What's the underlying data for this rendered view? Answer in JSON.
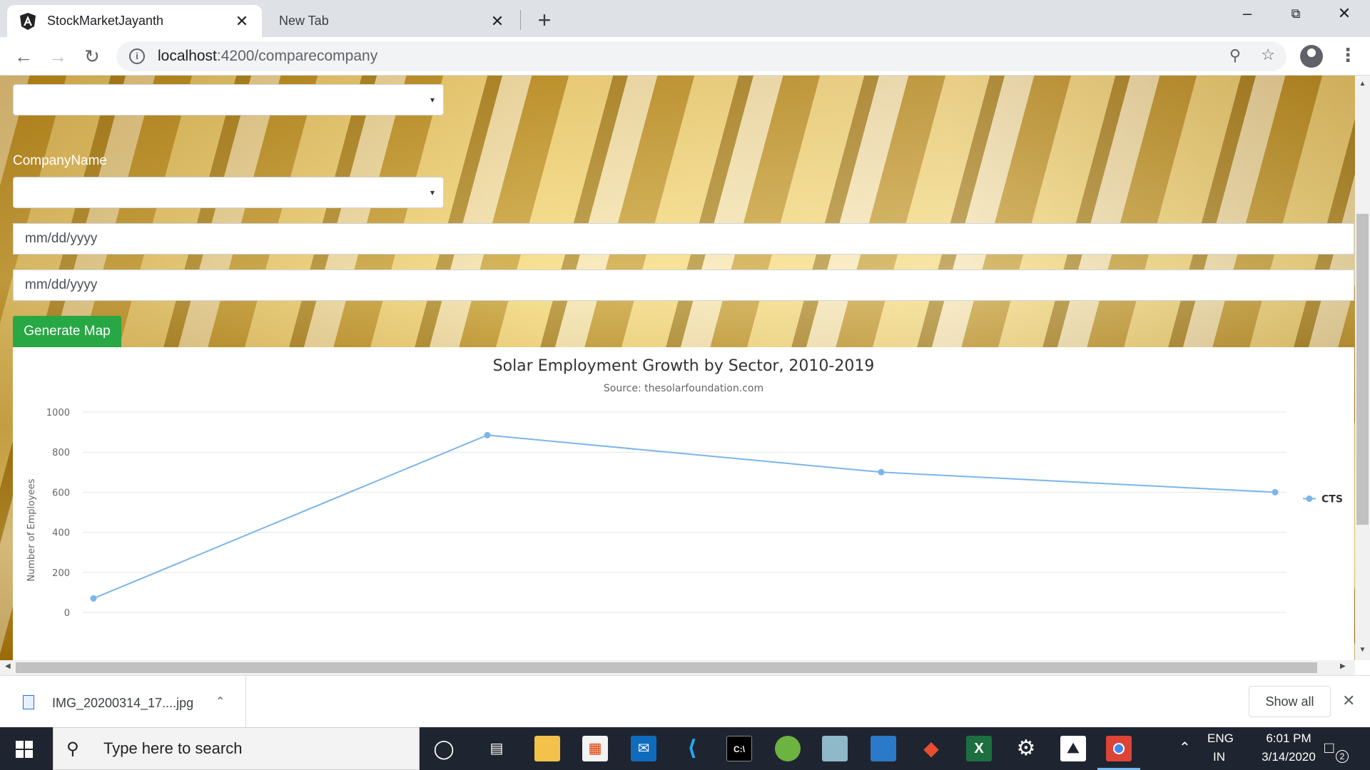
{
  "browser": {
    "tabs": [
      {
        "title": "StockMarketJayanth",
        "active": true
      },
      {
        "title": "New Tab",
        "active": false
      }
    ],
    "url_host": "localhost",
    "url_path": ":4200/comparecompany",
    "new_tab_symbol": "+",
    "close_symbol": "✕"
  },
  "form": {
    "company_label": "CompanyName",
    "caret": "▾",
    "from_date_placeholder": "mm/dd/yyyy",
    "to_date_placeholder": "mm/dd/yyyy",
    "generate_label": "Generate Map"
  },
  "chart_data": {
    "type": "line",
    "title": "Solar Employment Growth by Sector, 2010-2019",
    "subtitle": "Source: thesolarfoundation.com",
    "xlabel": "",
    "ylabel": "Number of Employees",
    "ylim": [
      0,
      1000
    ],
    "yticks": [
      0,
      200,
      400,
      600,
      800,
      1000
    ],
    "grid": true,
    "legend_position": "right",
    "series": [
      {
        "name": "CTS",
        "color": "#7cb5ec",
        "values": [
          70,
          885,
          700,
          600
        ]
      }
    ]
  },
  "download_bar": {
    "file_name": "IMG_20200314_17....jpg",
    "show_all_label": "Show all"
  },
  "taskbar": {
    "search_placeholder": "Type here to search",
    "language": "ENG",
    "region": "IN",
    "time": "6:01 PM",
    "date": "3/14/2020",
    "notification_count": "2"
  },
  "colors": {
    "accent_green": "#28a745",
    "series_blue": "#7cb5ec",
    "taskbar": "#1f2530"
  }
}
